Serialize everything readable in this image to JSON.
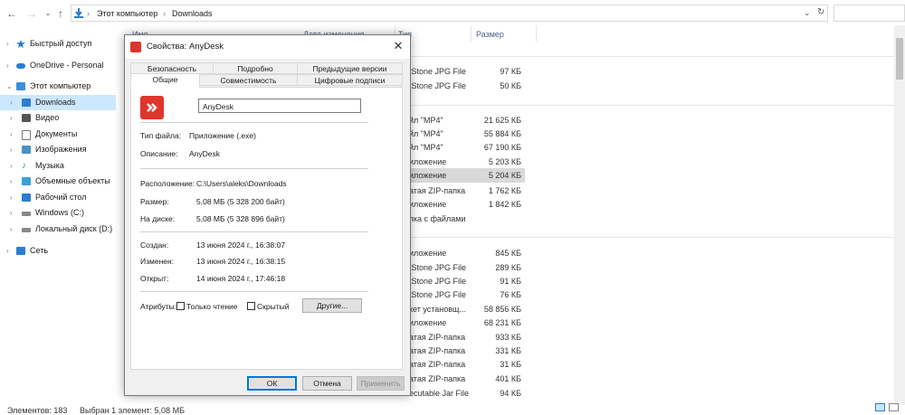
{
  "addressbar": {
    "crumbs": [
      "Этот компьютер",
      "Downloads"
    ]
  },
  "nav": {
    "items": [
      {
        "label": "Быстрый доступ",
        "icon": "star-icon",
        "color": "#2b7cd3"
      },
      {
        "label": "OneDrive - Personal",
        "icon": "cloud-icon",
        "color": "#2b7cd3"
      },
      {
        "label": "Этот компьютер",
        "icon": "computer-icon",
        "color": "#3c8fd6"
      },
      {
        "label": "Downloads",
        "icon": "download-icon",
        "color": "#2b7cd3"
      },
      {
        "label": "Видео",
        "icon": "video-icon",
        "color": "#555555"
      },
      {
        "label": "Документы",
        "icon": "document-icon",
        "color": "#777777"
      },
      {
        "label": "Изображения",
        "icon": "image-icon",
        "color": "#4a90c8"
      },
      {
        "label": "Музыка",
        "icon": "music-icon",
        "color": "#2b7cd3"
      },
      {
        "label": "Объемные объекты",
        "icon": "cube-icon",
        "color": "#3aa0d8"
      },
      {
        "label": "Рабочий стол",
        "icon": "desktop-icon",
        "color": "#2b7cd3"
      },
      {
        "label": "Windows (C:)",
        "icon": "drive-icon",
        "color": "#888888"
      },
      {
        "label": "Локальный диск (D:)",
        "icon": "drive-icon",
        "color": "#888888"
      },
      {
        "label": "Сеть",
        "icon": "network-icon",
        "color": "#2b7cd3"
      }
    ]
  },
  "filelist": {
    "columns": [
      "Имя",
      "Дата изменения",
      "Тип",
      "Размер"
    ],
    "rows": [
      {
        "type": "tStone JPG File",
        "size": "97 КБ"
      },
      {
        "type": "tStone JPG File",
        "size": "50 КБ"
      },
      {
        "type": "йл \"MP4\"",
        "size": "21 625 КБ"
      },
      {
        "type": "йл \"MP4\"",
        "size": "55 884 КБ"
      },
      {
        "type": "йл \"MP4\"",
        "size": "67 190 КБ"
      },
      {
        "type": "иложение",
        "size": "5 203 КБ"
      },
      {
        "type": "иложение",
        "size": "5 204 КБ"
      },
      {
        "type": "атая ZIP-папка",
        "size": "1 762 КБ"
      },
      {
        "type": "иложение",
        "size": "1 842 КБ"
      },
      {
        "type": "пка с файлами",
        "size": ""
      },
      {
        "type": "иложение",
        "size": "845 КБ"
      },
      {
        "type": "tStone JPG File",
        "size": "289 КБ"
      },
      {
        "type": "tStone JPG File",
        "size": "91 КБ"
      },
      {
        "type": "tStone JPG File",
        "size": "76 КБ"
      },
      {
        "type": "кет установщ...",
        "size": "58 856 КБ"
      },
      {
        "type": "иложение",
        "size": "68 231 КБ"
      },
      {
        "type": "атая ZIP-папка",
        "size": "933 КБ"
      },
      {
        "type": "атая ZIP-папка",
        "size": "331 КБ"
      },
      {
        "type": "атая ZIP-папка",
        "size": "31 КБ"
      },
      {
        "type": "атая ZIP-папка",
        "size": "401 КБ"
      },
      {
        "type": "ecutable Jar File",
        "size": "94 КБ"
      }
    ]
  },
  "status": {
    "count": "Элементов: 183",
    "selected": "Выбран 1 элемент: 5,08 МБ"
  },
  "dialog": {
    "title": "Свойства: AnyDesk",
    "tabs_row1": [
      "Безопасность",
      "Подробно",
      "Предыдущие версии"
    ],
    "tabs_row2": [
      "Общие",
      "Совместимость",
      "Цифровые подписи"
    ],
    "name": "AnyDesk",
    "type_label": "Тип файла:",
    "type_value": "Приложение (.exe)",
    "desc_label": "Описание:",
    "desc_value": "AnyDesk",
    "location_label": "Расположение:",
    "location_value": "C:\\Users\\aleks\\Downloads",
    "size_label": "Размер:",
    "size_value": "5,08 МБ (5 328 200 байт)",
    "disk_label": "На диске:",
    "disk_value": "5,08 МБ (5 328 896 байт)",
    "created_label": "Создан:",
    "created_value": "13 июня 2024 г., 16:38:07",
    "modified_label": "Изменен:",
    "modified_value": "13 июня 2024 г., 16:38:15",
    "opened_label": "Открыт:",
    "opened_value": "14 июня 2024 г., 17:46:18",
    "attributes_label": "Атрибуты:",
    "readonly_label": "Только чтение",
    "hidden_label": "Скрытый",
    "other_button": "Другие...",
    "ok_button": "ОК",
    "cancel_button": "Отмена",
    "apply_button": "Применить",
    "accent_color": "#e0352b"
  }
}
